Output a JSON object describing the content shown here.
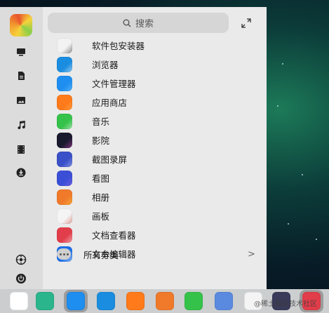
{
  "search": {
    "placeholder": "搜索",
    "icon": "search-icon"
  },
  "sidebar": {
    "items": [
      {
        "name": "computer-icon"
      },
      {
        "name": "documents-icon"
      },
      {
        "name": "pictures-icon"
      },
      {
        "name": "music-icon"
      },
      {
        "name": "video-icon"
      },
      {
        "name": "download-icon"
      }
    ],
    "bottom": [
      {
        "name": "settings-icon"
      },
      {
        "name": "power-icon"
      }
    ]
  },
  "apps": [
    {
      "label": "软件包安装器",
      "color": "#f2f2f2",
      "accent": "#222222"
    },
    {
      "label": "浏览器",
      "color": "#1a8de0",
      "accent": "#ffffff"
    },
    {
      "label": "文件管理器",
      "color": "#1e8ef0",
      "accent": "#7fd0ff"
    },
    {
      "label": "应用商店",
      "color": "#ff7a1a",
      "accent": "#ffb85a"
    },
    {
      "label": "音乐",
      "color": "#35c24a",
      "accent": "#ffffff"
    },
    {
      "label": "影院",
      "color": "#1a1a2e",
      "accent": "#e04bd0"
    },
    {
      "label": "截图录屏",
      "color": "#3a50c8",
      "accent": "#c8d4ff"
    },
    {
      "label": "看图",
      "color": "#3b4fd6",
      "accent": "#9a6cf0"
    },
    {
      "label": "相册",
      "color": "#f07a2a",
      "accent": "#ffd24a"
    },
    {
      "label": "画板",
      "color": "#f4f4f4",
      "accent": "#d04a3a"
    },
    {
      "label": "文档查看器",
      "color": "#e23d4a",
      "accent": "#ffffff"
    },
    {
      "label": "文本编辑器",
      "color": "#1e6fe8",
      "accent": "#ffffff"
    }
  ],
  "all_categories": {
    "label": "所有分类",
    "chevron": ">"
  },
  "dock": [
    {
      "name": "launcher-icon",
      "color": "#ffffff"
    },
    {
      "name": "multitask-icon",
      "color": "#2ab58c"
    },
    {
      "name": "file-manager-icon",
      "color": "#1e8ef0",
      "active": true
    },
    {
      "name": "browser-icon",
      "color": "#1a8de0"
    },
    {
      "name": "app-store-icon",
      "color": "#ff7a1a"
    },
    {
      "name": "album-icon",
      "color": "#f07a2a"
    },
    {
      "name": "music-icon",
      "color": "#35c24a"
    },
    {
      "name": "contacts-icon",
      "color": "#5a8ae0"
    },
    {
      "name": "calendar-icon",
      "color": "#f4f4f4"
    },
    {
      "name": "control-center-icon",
      "color": "#3a3a5a"
    },
    {
      "name": "doc-viewer-icon",
      "color": "#e23d4a",
      "active": true
    }
  ],
  "watermark": "@稀土掘金技术社区"
}
